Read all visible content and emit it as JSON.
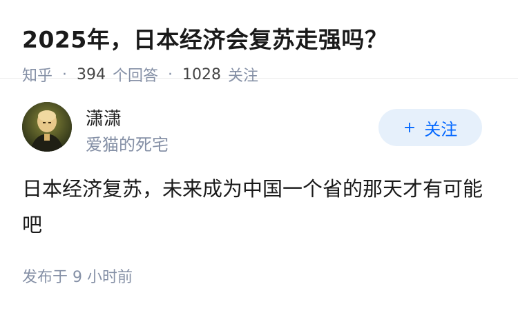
{
  "question": {
    "title": "2025年，日本经济会复苏走强吗？",
    "site": "知乎",
    "answers_count": "394",
    "answers_label": "个回答",
    "followers_count": "1028",
    "followers_label": "关注"
  },
  "answer": {
    "author_name": "潇潇",
    "author_bio": "爱猫的死宅",
    "follow_label": "关注",
    "content": "日本经济复苏，未来成为中国一个省的那天才有可能吧",
    "published_prefix": "发布于",
    "published_time": "9 小时前"
  },
  "colors": {
    "meta_gray": "#8590a6",
    "follow_blue": "#0066ff",
    "follow_bg": "#e6f0fb"
  }
}
